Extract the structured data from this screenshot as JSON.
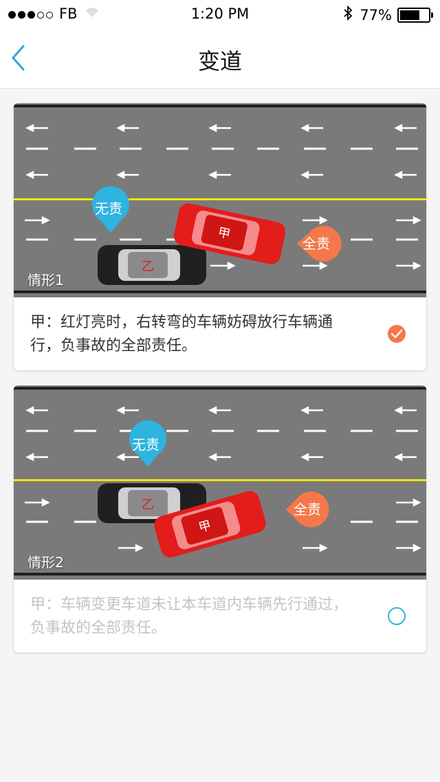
{
  "status_bar": {
    "carrier": "FB",
    "time": "1:20 PM",
    "battery_percent": "77%",
    "battery_level": 0.77,
    "signal_bars_filled": 3,
    "signal_bars_total": 5
  },
  "nav": {
    "title": "变道",
    "back_icon": "chevron-left-icon"
  },
  "scenarios": [
    {
      "caption": "情形1",
      "description": "甲：红灯亮时，右转弯的车辆妨碍放行车辆通行，负事故的全部责任。",
      "selected": true,
      "car_a_label": "甲",
      "car_b_label": "乙",
      "tag_no_fault": "无责",
      "tag_full_fault": "全责"
    },
    {
      "caption": "情形2",
      "description": "甲：车辆变更车道未让本车道内车辆先行通过，负事故的全部责任。",
      "selected": false,
      "car_a_label": "甲",
      "car_b_label": "乙",
      "tag_no_fault": "无责",
      "tag_full_fault": "全责"
    }
  ],
  "colors": {
    "road": "#7a7a7a",
    "center_line": "#f2e600",
    "tag_no_fault": "#2fb3e0",
    "tag_full_fault": "#f4784a",
    "car_a": "#e31c1c",
    "car_b": "#2a2a2a",
    "radio_checked": "#f4784a",
    "radio_unchecked": "#2fb3d9"
  }
}
